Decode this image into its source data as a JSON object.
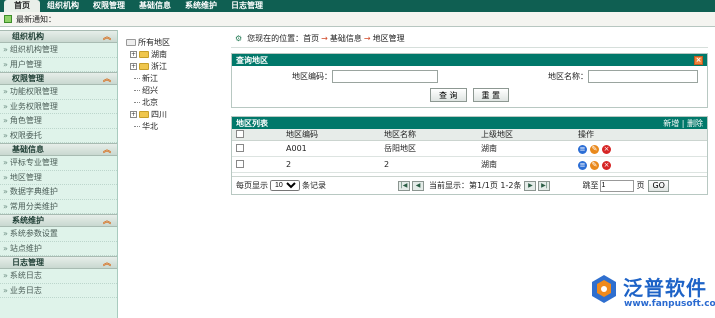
{
  "topnav": {
    "tabs": [
      "首页",
      "组织机构",
      "权限管理",
      "基础信息",
      "系统维护",
      "日志管理"
    ]
  },
  "notice": {
    "label": "最新通知："
  },
  "sidebar": {
    "groups": [
      {
        "title": "组织机构",
        "items": [
          "组织机构管理",
          "用户管理"
        ]
      },
      {
        "title": "权限管理",
        "items": [
          "功能权限管理",
          "业务权限管理",
          "角色管理",
          "权限委托"
        ]
      },
      {
        "title": "基础信息",
        "items": [
          "评标专业管理",
          "地区管理",
          "数据字典维护",
          "常用分类维护"
        ]
      },
      {
        "title": "系统维护",
        "items": [
          "系统参数设置",
          "站点维护"
        ]
      },
      {
        "title": "日志管理",
        "items": [
          "系统日志",
          "业务日志"
        ]
      }
    ]
  },
  "tree": {
    "root": "所有地区",
    "nodes": [
      "湖南",
      "浙江",
      "新江",
      "绍兴",
      "北京",
      "四川",
      "华北"
    ]
  },
  "breadcrumb": {
    "prefix": "您现在的位置：",
    "path": [
      "首页",
      "基础信息",
      "地区管理"
    ],
    "sep": "→"
  },
  "query": {
    "title": "查询地区",
    "code_label": "地区编码：",
    "name_label": "地区名称：",
    "code_value": "",
    "name_value": "",
    "search": "查 询",
    "reset": "重 置"
  },
  "list": {
    "title": "地区列表",
    "add": "新增",
    "delete": "删除",
    "sep": "|",
    "columns": [
      "",
      "地区编码",
      "地区名称",
      "上级地区",
      "操作"
    ],
    "rows": [
      {
        "code": "A001",
        "name": "岳阳地区",
        "parent": "湖南"
      },
      {
        "code": "2",
        "name": "2",
        "parent": "湖南"
      }
    ]
  },
  "pager": {
    "per_page_label": "每页显示",
    "per_page": "10",
    "records": "条记录",
    "current": "当前显示：第1/1页 1-2条",
    "goto": "跳至",
    "goto_value": "1",
    "page_unit": "页",
    "go": "GO"
  },
  "logo": {
    "name": "泛普软件",
    "url": "www.fanpusoft.com"
  }
}
